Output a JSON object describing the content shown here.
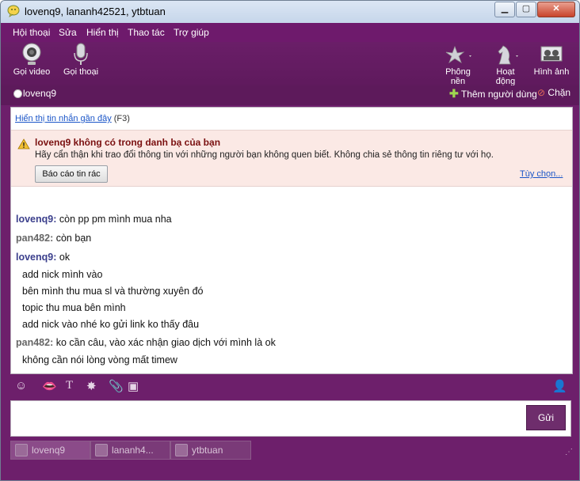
{
  "window": {
    "title": "lovenq9, lananh42521, ytbtuan"
  },
  "menu": [
    "Hội thoại",
    "Sửa",
    "Hiển thị",
    "Thao tác",
    "Trợ giúp"
  ],
  "toolbar": {
    "video_call": "Gọi video",
    "voice_call": "Gọi thoại",
    "background": "Phông nền",
    "activity": "Hoạt động",
    "pictures": "Hình ảnh"
  },
  "status": {
    "name": "lovenq9",
    "add_people": "Thêm người dùng",
    "block": "Chặn"
  },
  "recent": {
    "link": "Hiển thị tin nhắn gần đây",
    "shortcut": "(F3)"
  },
  "warning": {
    "title": "lovenq9 không có trong danh bạ của bạn",
    "text": "Hãy cẩn thận khi trao đổi thông tin với những người bạn không quen biết. Không chia sẻ thông tin riêng tư với họ.",
    "report_button": "Báo cáo tin rác",
    "options_link": "Tùy chọn..."
  },
  "messages": [
    {
      "sender": "lovenq9:",
      "text": "còn pp pm mình mua nha"
    },
    {
      "sender": "pan482:",
      "text": "còn bạn"
    },
    {
      "sender": "lovenq9:",
      "text": "ok"
    },
    {
      "sender": "",
      "text": "add nick mình vào"
    },
    {
      "sender": "",
      "text": "bên mình thu mua sl và thường xuyên đó"
    },
    {
      "sender": "",
      "text": "topic thu mua bên mình"
    },
    {
      "sender": "",
      "text": "add nick vào nhé ko gửi link ko thấy đâu"
    },
    {
      "sender": "pan482:",
      "text": "ko cần câu, vào xác nhận giao dịch với mình là ok"
    },
    {
      "sender": "",
      "text": "không cần nói lòng vòng mất timew"
    }
  ],
  "send_button": "Gửi",
  "tabs": [
    "lovenq9",
    "lananh4...",
    "ytbtuan"
  ],
  "colors": {
    "frame": "#6d1f6b",
    "send": "#6e2d6c",
    "warning_bg": "#fbe9e5",
    "link": "#1a55c8"
  }
}
